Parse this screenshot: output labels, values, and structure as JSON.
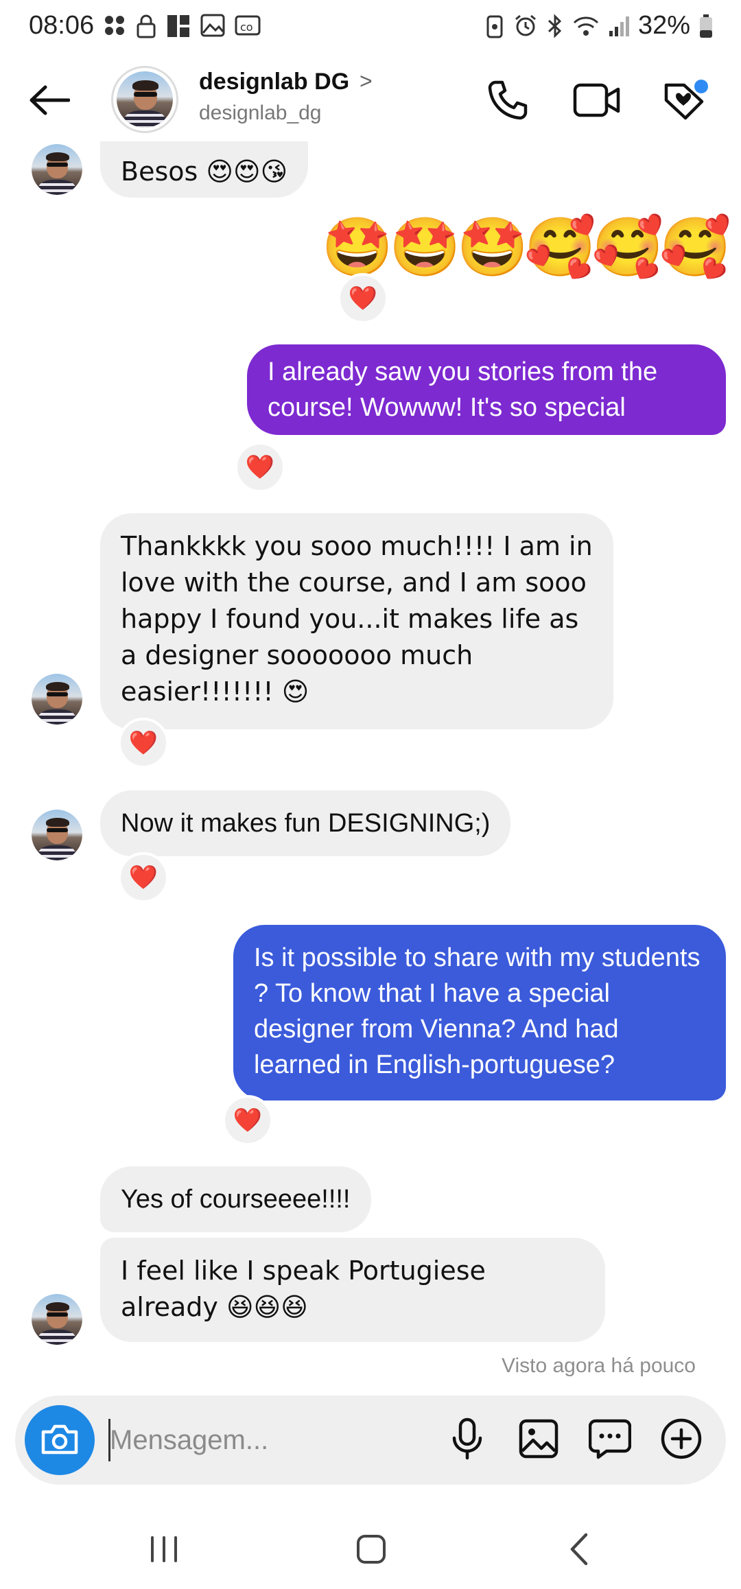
{
  "status_bar": {
    "time": "08:06",
    "battery_text": "32%"
  },
  "header": {
    "name": "designlab DG",
    "chevron": ">",
    "username": "designlab_dg",
    "icons": [
      "back-arrow-icon",
      "phone-icon",
      "video-camera-icon",
      "heart-tag-icon"
    ],
    "notification_color": "#2f8bf3"
  },
  "messages": [
    {
      "id": "m1",
      "side": "in",
      "text": "Besos 😍😍😘"
    },
    {
      "id": "m2",
      "side": "out",
      "text": "🤩🤩🤩🥰🥰🥰",
      "reaction": "❤️"
    },
    {
      "id": "m3",
      "side": "out",
      "color": "#7d2ad1",
      "text": "I already saw you stories from the course!  Wowww!  It's so special",
      "reaction": "❤️"
    },
    {
      "id": "m4",
      "side": "in",
      "text": "Thankkkk you sooo much!!!! I am in love with the course, and I am sooo happy I found you...it makes life as a designer sooooooo much easier!!!!!!! 😍",
      "reaction": "❤️"
    },
    {
      "id": "m5",
      "side": "in",
      "text": "Now it makes fun DESIGNING;)",
      "reaction": "❤️"
    },
    {
      "id": "m6",
      "side": "out",
      "color": "#3b5bdb",
      "text": "Is it possible to share with my students ?  To know that I have a special designer from Vienna? And had learned in English-portuguese?",
      "reaction": "❤️"
    },
    {
      "id": "m7",
      "side": "in",
      "text": "Yes of courseeee!!!!"
    },
    {
      "id": "m8",
      "side": "in",
      "text": "I feel like I speak Portugiese already 😆😆😆"
    }
  ],
  "seen_text": "Visto agora há pouco",
  "composer": {
    "placeholder": "Mensagem...",
    "icons": [
      "camera-icon",
      "microphone-icon",
      "gallery-icon",
      "sticker-chat-icon",
      "add-circle-icon"
    ],
    "camera_color": "#1e88e5"
  },
  "navbar": {
    "icons": [
      "recent-apps-icon",
      "home-icon",
      "back-icon"
    ]
  }
}
